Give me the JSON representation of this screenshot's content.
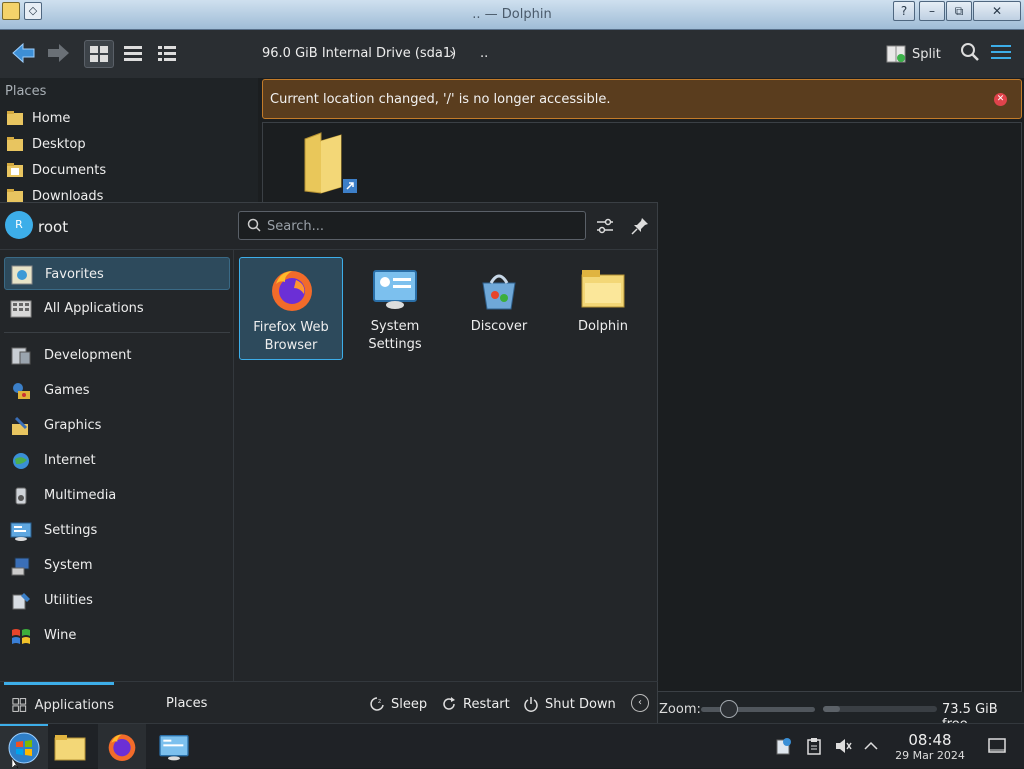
{
  "window": {
    "title": ".. — Dolphin",
    "help_label": "?",
    "restore_label": "⧉",
    "minimize_label": "–",
    "maximize_label": "□",
    "close_label": "✕",
    "menu_glyph": "◇"
  },
  "toolbar": {
    "breadcrumb": "96.0 GiB Internal Drive (sda1)",
    "breadcrumb_chevron": "›",
    "breadcrumb_current": "..",
    "split_label": "Split"
  },
  "places": {
    "title": "Places",
    "items": [
      {
        "label": "Home",
        "icon": "home-folder-icon"
      },
      {
        "label": "Desktop",
        "icon": "desktop-folder-icon"
      },
      {
        "label": "Documents",
        "icon": "documents-folder-icon"
      },
      {
        "label": "Downloads",
        "icon": "downloads-folder-icon"
      }
    ]
  },
  "banner": {
    "text": "Current location changed, '/' is no longer accessible.",
    "close_glyph": "✕"
  },
  "statusbar": {
    "zoom_label": "Zoom:",
    "zoom_level": 0.2,
    "free_label": "73.5 GiB free",
    "space_used_fraction": 0.15
  },
  "launcher": {
    "user": {
      "initial": "R",
      "name": "root"
    },
    "search": {
      "placeholder": "Search..."
    },
    "categories": [
      {
        "label": "Favorites",
        "icon": "favorites-icon",
        "selected": true
      },
      {
        "label": "All Applications",
        "icon": "all-applications-icon"
      },
      {
        "label": "Development",
        "icon": "development-icon"
      },
      {
        "label": "Games",
        "icon": "games-icon"
      },
      {
        "label": "Graphics",
        "icon": "graphics-icon"
      },
      {
        "label": "Internet",
        "icon": "internet-icon"
      },
      {
        "label": "Multimedia",
        "icon": "multimedia-icon"
      },
      {
        "label": "Settings",
        "icon": "settings-icon"
      },
      {
        "label": "System",
        "icon": "system-icon"
      },
      {
        "label": "Utilities",
        "icon": "utilities-icon"
      },
      {
        "label": "Wine",
        "icon": "wine-icon"
      }
    ],
    "favorites": [
      {
        "line1": "Firefox Web",
        "line2": "Browser",
        "icon": "firefox-icon",
        "selected": true
      },
      {
        "line1": "System",
        "line2": "Settings",
        "icon": "system-settings-icon"
      },
      {
        "line1": "Discover",
        "line2": "",
        "icon": "discover-icon"
      },
      {
        "line1": "Dolphin",
        "line2": "",
        "icon": "dolphin-icon"
      }
    ],
    "footer": {
      "tab_applications": "Applications",
      "tab_places": "Places",
      "sleep": "Sleep",
      "restart": "Restart",
      "shutdown": "Shut Down",
      "more_glyph": "‹"
    }
  },
  "taskbar": {
    "clock_time": "08:48",
    "clock_date": "29 Mar 2024"
  },
  "colors": {
    "accent": "#3daee9",
    "banner_bg": "#5a3d1e",
    "banner_border": "#c27b2a",
    "panel_bg": "#232629"
  }
}
